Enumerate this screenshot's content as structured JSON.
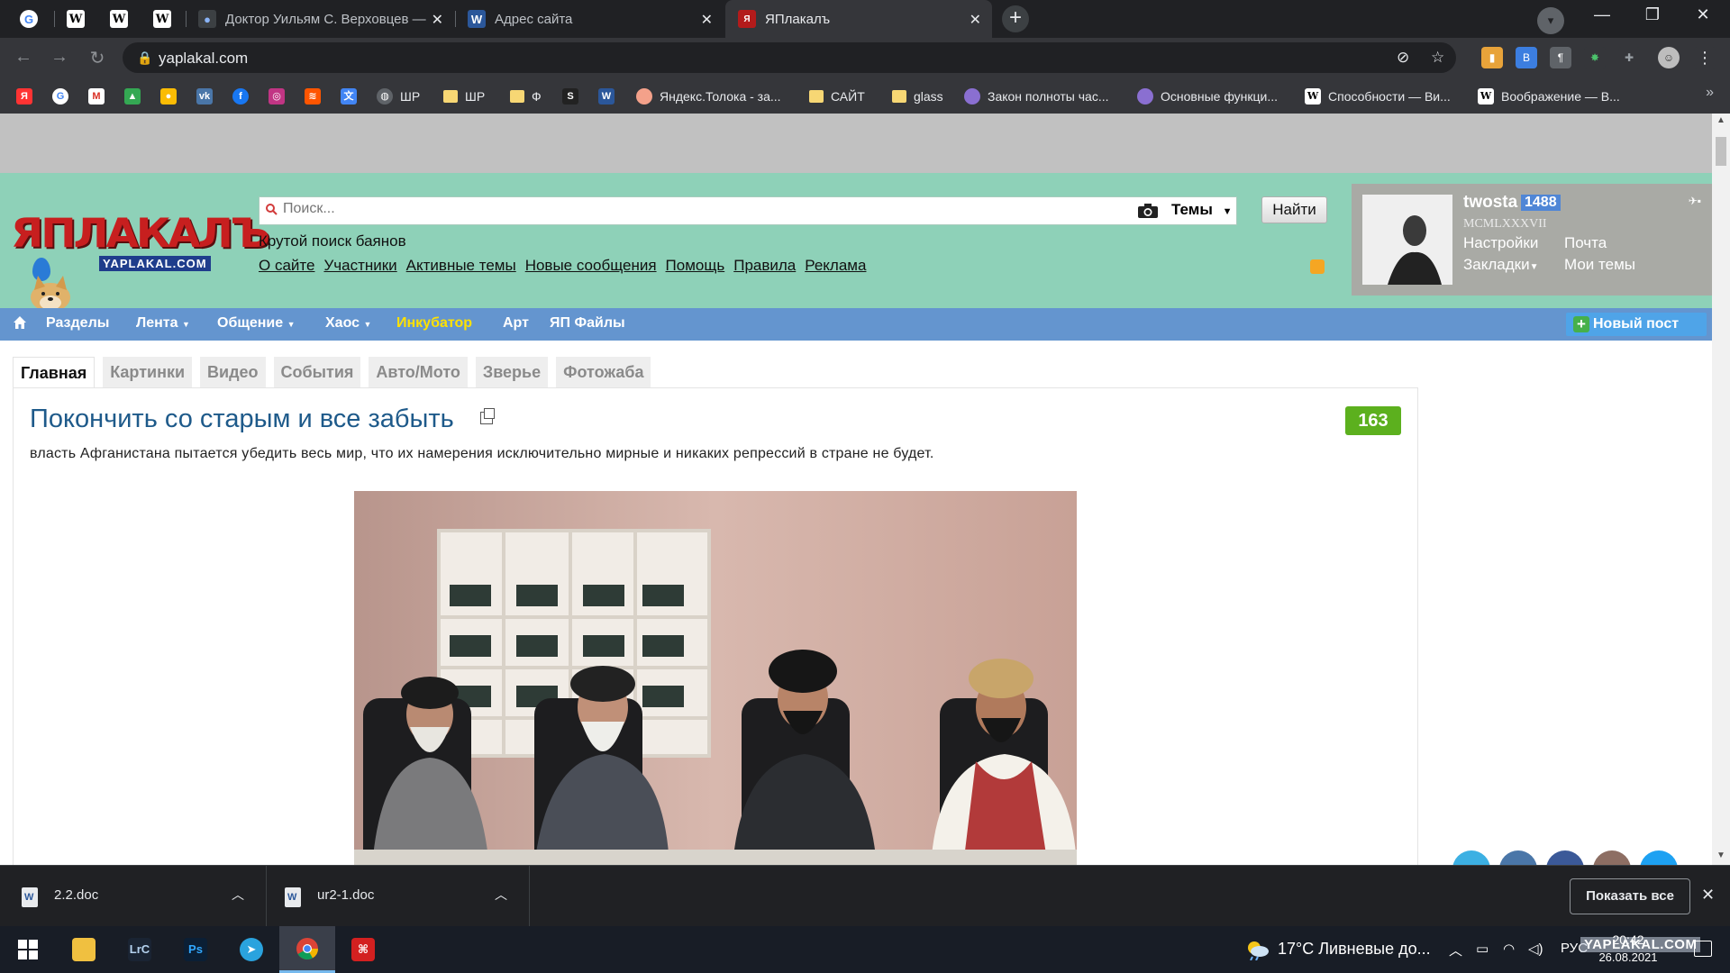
{
  "browser": {
    "tabs": [
      {
        "title": "",
        "icon": "google-icon"
      },
      {
        "title": "",
        "icon": "wikipedia-icon"
      },
      {
        "title": "",
        "icon": "wikipedia-icon"
      },
      {
        "title": "",
        "icon": "wikipedia-icon"
      },
      {
        "title": "Доктор Уильям С. Верховцев —",
        "icon": "person-icon"
      },
      {
        "title": "Адрес сайта",
        "icon": "word-icon"
      },
      {
        "title": "ЯПлакалъ",
        "icon": "yaplakal-icon",
        "active": true
      }
    ],
    "url": "yaplakal.com",
    "bookmarks": [
      {
        "label": "",
        "icon": "yandex-icon",
        "color": "#f33"
      },
      {
        "label": "",
        "icon": "google-icon",
        "color": "#4285f4"
      },
      {
        "label": "",
        "icon": "gmail-icon",
        "color": "#d93025"
      },
      {
        "label": "",
        "icon": "drive-icon",
        "color": "#34a853"
      },
      {
        "label": "",
        "icon": "maps-icon",
        "color": "#fbbc04"
      },
      {
        "label": "",
        "icon": "vk-icon",
        "color": "#4a76a8"
      },
      {
        "label": "",
        "icon": "facebook-icon",
        "color": "#1877f2"
      },
      {
        "label": "",
        "icon": "instagram-icon",
        "color": "#c13584"
      },
      {
        "label": "",
        "icon": "soundcloud-icon",
        "color": "#ff5500"
      },
      {
        "label": "",
        "icon": "translate-icon",
        "color": "#4285f4"
      },
      {
        "label": "ШР",
        "icon": "globe-icon",
        "color": "#5f6368"
      },
      {
        "label": "ШР",
        "icon": "folder-icon"
      },
      {
        "label": "Ф",
        "icon": "folder-icon"
      },
      {
        "label": "",
        "icon": "sta-icon",
        "color": "#222"
      },
      {
        "label": "",
        "icon": "word-icon",
        "color": "#2b579a"
      },
      {
        "label": "Яндекс.Толока - за...",
        "icon": "toloka-icon",
        "color": "#f4a18a"
      },
      {
        "label": "САЙТ",
        "icon": "folder-icon"
      },
      {
        "label": "glass",
        "icon": "folder-icon"
      },
      {
        "label": "Закон полноты час...",
        "icon": "circle-icon",
        "color": "#8a6fd1"
      },
      {
        "label": "Основные функци...",
        "icon": "circle-icon",
        "color": "#8a6fd1"
      },
      {
        "label": "Способности — Ви...",
        "icon": "wikipedia-icon",
        "color": "#fff"
      },
      {
        "label": "Воображение — В...",
        "icon": "wikipedia-icon",
        "color": "#fff"
      }
    ],
    "bookmarks_more": "»"
  },
  "site": {
    "logo_text": "ЯПЛАКАЛЪ",
    "logo_sub": "YAPLAKAL.COM",
    "search_placeholder": "Поиск...",
    "themes_label": "Темы",
    "find_button": "Найти",
    "tagline": "Крутой поиск баянов",
    "top_links": [
      "О сайте",
      "Участники",
      "Активные темы",
      "Новые сообщения",
      "Помощь",
      "Правила",
      "Реклама"
    ],
    "user": {
      "name": "twosta",
      "count": "1488",
      "roman": "MCMLXXXVII",
      "links": {
        "settings": "Настройки",
        "mail": "Почта",
        "bookmarks": "Закладки",
        "my_topics": "Мои темы"
      }
    },
    "nav": [
      "Разделы",
      "Лента",
      "Общение",
      "Хаос",
      "Инкубатор",
      "Арт",
      "ЯП Файлы"
    ],
    "new_post": "Новый пост",
    "content_tabs": [
      "Главная",
      "Картинки",
      "Видео",
      "События",
      "Авто/Мото",
      "Зверье",
      "Фотожаба"
    ],
    "post": {
      "title": "Покончить со старым и все забыть",
      "comments": "163",
      "text": "власть Афганистана пытается убедить весь мир, что их намерения исключительно мирные и никаких репрессий в стране не будет."
    }
  },
  "downloads": {
    "items": [
      {
        "name": "2.2.doc"
      },
      {
        "name": "ur2-1.doc"
      }
    ],
    "show_all": "Показать все"
  },
  "taskbar": {
    "apps": [
      {
        "name": "explorer-icon",
        "label": ""
      },
      {
        "name": "lightroom-icon",
        "label": "LrC"
      },
      {
        "name": "photoshop-icon",
        "label": "Ps"
      },
      {
        "name": "telegram-icon",
        "label": ""
      },
      {
        "name": "chrome-icon",
        "label": ""
      },
      {
        "name": "acrobat-icon",
        "label": ""
      }
    ],
    "weather": "17°C  Ливневые до...",
    "lang": "РУС",
    "time": "20:42",
    "date": "26.08.2021",
    "watermark": "YAPLAKAL.COM"
  }
}
